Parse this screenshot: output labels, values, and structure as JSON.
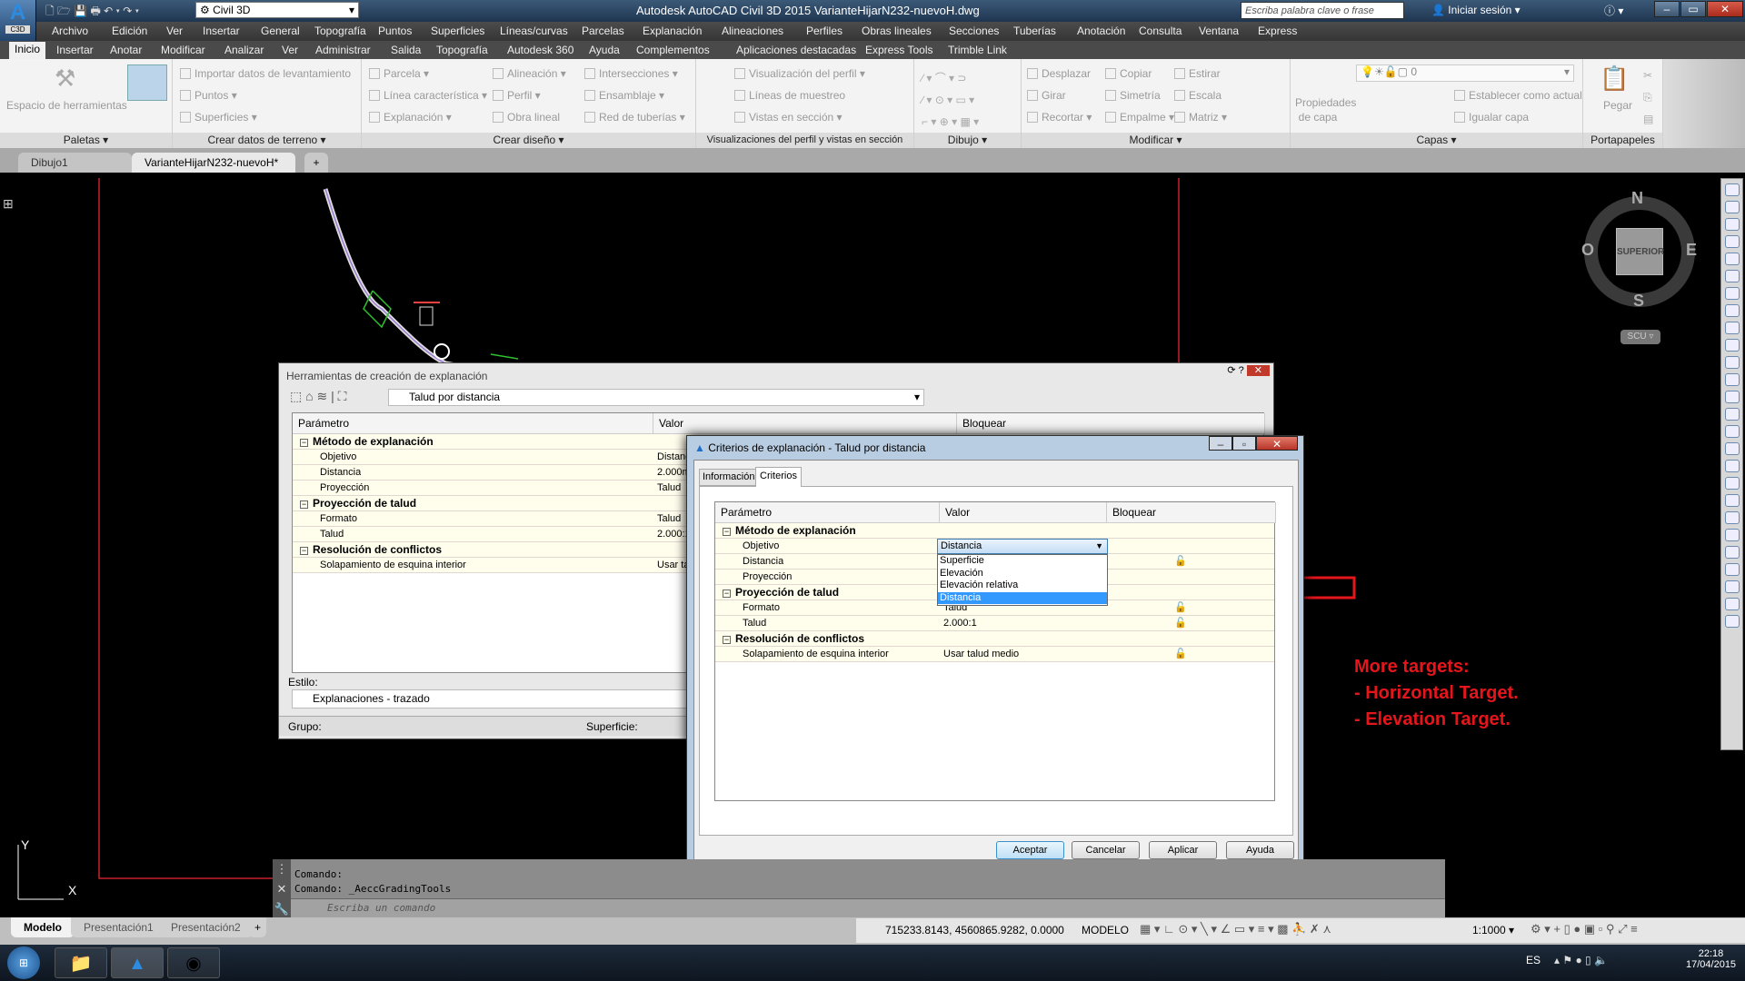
{
  "app": {
    "title": "Autodesk AutoCAD Civil 3D 2015   VarianteHijarN232-nuevoH.dwg",
    "app_badge": "C3D",
    "workspace": "Civil 3D",
    "search_placeholder": "Escriba palabra clave o frase",
    "sign_in": "Iniciar sesión"
  },
  "menu": [
    "Archivo",
    "Edición",
    "Ver",
    "Insertar",
    "General",
    "Topografía",
    "Puntos",
    "Superficies",
    "Líneas/curvas",
    "Parcelas",
    "Explanación",
    "Alineaciones",
    "Perfiles",
    "Obras lineales",
    "Secciones",
    "Tuberías",
    "Anotación",
    "Consulta",
    "Ventana",
    "Express"
  ],
  "ribbon_tabs": [
    "Inicio",
    "Insertar",
    "Anotar",
    "Modificar",
    "Analizar",
    "Ver",
    "Administrar",
    "Salida",
    "Topografía",
    "Autodesk 360",
    "Ayuda",
    "Complementos",
    "Aplicaciones destacadas",
    "Express Tools",
    "Trimble Link"
  ],
  "ribbon": {
    "paletas": {
      "label": "Paletas ▾",
      "tool": "Espacio de herramientas"
    },
    "terreno": {
      "label": "Crear datos de terreno ▾",
      "items": [
        "Importar datos de levantamiento",
        "Puntos ▾",
        "Superficies ▾"
      ]
    },
    "diseno": {
      "label": "Crear diseño ▾",
      "items": [
        "Parcela ▾",
        "Línea característica ▾",
        "Explanación ▾",
        "Alineación ▾",
        "Perfil ▾",
        "Obra lineal",
        "Intersecciones ▾",
        "Ensamblaje ▾",
        "Red de tuberías ▾"
      ]
    },
    "perfil": {
      "label": "Visualizaciones del perfil y vistas en sección",
      "items": [
        "Visualización del perfil ▾",
        "Líneas de muestreo",
        "Vistas en sección ▾"
      ]
    },
    "dibujo": {
      "label": "Dibujo ▾"
    },
    "modificar": {
      "label": "Modificar ▾",
      "items": [
        "Desplazar",
        "Girar",
        "Recortar ▾",
        "Copiar",
        "Simetría",
        "Empalme ▾",
        "Estirar",
        "Escala",
        "Matriz ▾"
      ]
    },
    "capas": {
      "label": "Capas ▾",
      "props": "Propiedades de capa",
      "layer": "0",
      "items": [
        "Establecer como actual",
        "Igualar capa"
      ]
    },
    "portapapeles": {
      "label": "Portapapeles",
      "paste": "Pegar"
    }
  },
  "file_tabs": [
    "Dibujo1",
    "VarianteHijarN232-nuevoH*"
  ],
  "viewcube": {
    "n": "N",
    "s": "S",
    "e": "E",
    "w": "O",
    "face": "SUPERIOR",
    "ucs": "SCU"
  },
  "tools_dialog": {
    "title": "Herramientas de creación de explanación",
    "criteria": "Talud por distancia",
    "headers": [
      "Parámetro",
      "Valor",
      "Bloquear"
    ],
    "rows": [
      {
        "group": true,
        "param": "Método de explanación",
        "value": ""
      },
      {
        "param": "Objetivo",
        "value": "Distancia"
      },
      {
        "param": "Distancia",
        "value": "2.000m"
      },
      {
        "param": "Proyección",
        "value": "Talud"
      },
      {
        "group": true,
        "param": "Proyección de talud",
        "value": ""
      },
      {
        "param": "Formato",
        "value": "Talud"
      },
      {
        "param": "Talud",
        "value": "2.000:1"
      },
      {
        "group": true,
        "param": "Resolución de conflictos",
        "value": ""
      },
      {
        "param": "Solapamiento de esquina interior",
        "value": "Usar talud medio"
      }
    ],
    "style_label": "Estilo:",
    "style_value": "Explanaciones - trazado",
    "group_label": "Grupo:",
    "surface_label": "Superficie:"
  },
  "criteria_dialog": {
    "title": "Criterios de explanación - Talud por distancia",
    "tabs": [
      "Información",
      "Criterios"
    ],
    "headers": [
      "Parámetro",
      "Valor",
      "Bloquear"
    ],
    "rows": [
      {
        "group": true,
        "param": "Método de explanación",
        "value": "",
        "lock": false
      },
      {
        "param": "Objetivo",
        "value": "Distancia",
        "lock": false
      },
      {
        "param": "Distancia",
        "value": "2.000m",
        "lock": true
      },
      {
        "param": "Proyección",
        "value": "Talud",
        "lock": false
      },
      {
        "group": true,
        "param": "Proyección de talud",
        "value": "",
        "lock": false
      },
      {
        "param": "Formato",
        "value": "Talud",
        "lock": true
      },
      {
        "param": "Talud",
        "value": "2.000:1",
        "lock": true
      },
      {
        "group": true,
        "param": "Resolución de conflictos",
        "value": "",
        "lock": false
      },
      {
        "param": "Solapamiento de esquina interior",
        "value": "Usar talud medio",
        "lock": true
      }
    ],
    "dropdown_options": [
      "Superficie",
      "Elevación",
      "Elevación relativa",
      "Distancia"
    ],
    "dropdown_selected": "Distancia",
    "buttons": [
      "Aceptar",
      "Cancelar",
      "Aplicar",
      "Ayuda"
    ]
  },
  "annotation": {
    "lines": [
      "More targets:",
      "- Horizontal Target.",
      "- Elevation Target."
    ],
    "color": "#e4161c"
  },
  "command": {
    "history": [
      "Comando:",
      "Comando:  _AeccGradingTools"
    ],
    "placeholder": "Escriba un comando"
  },
  "layout_tabs": [
    "Modelo",
    "Presentación1",
    "Presentación2"
  ],
  "status": {
    "coords": "715233.8143, 4560865.9282, 0.0000",
    "space": "MODELO",
    "scale": "1:1000"
  },
  "taskbar": {
    "lang": "ES",
    "time": "22:18",
    "date": "17/04/2015"
  },
  "axis": {
    "y": "Y",
    "x": "X"
  }
}
